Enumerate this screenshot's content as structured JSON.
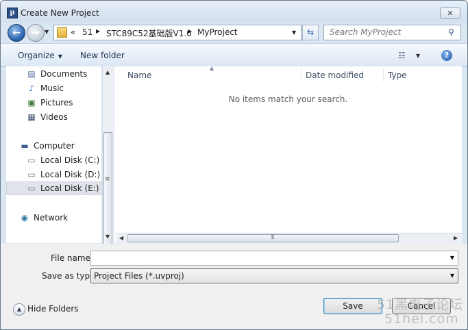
{
  "window": {
    "title": "Create New Project",
    "close_glyph": "✕",
    "app_glyph": "µ"
  },
  "nav": {
    "back_glyph": "←",
    "forward_glyph": "→",
    "history_glyph": "▼",
    "breadcrumbs": [
      "«",
      "51",
      "STC89C52基础版V1.0",
      "MyProject"
    ],
    "separator_glyph": "▶",
    "dropdown_glyph": "▼",
    "refresh_glyph": "⇆",
    "search_placeholder": "Search MyProject",
    "search_glyph": "⚲"
  },
  "toolbar": {
    "organize_label": "Organize",
    "new_folder_label": "New folder",
    "views_glyph": "☷",
    "help_glyph": "?",
    "arrow_glyph": "▼"
  },
  "sidebar": {
    "items": [
      {
        "label": "Documents",
        "icon": "documents-icon",
        "glyph": "▤"
      },
      {
        "label": "Music",
        "icon": "music-icon",
        "glyph": "♪"
      },
      {
        "label": "Pictures",
        "icon": "pictures-icon",
        "glyph": "▣"
      },
      {
        "label": "Videos",
        "icon": "videos-icon",
        "glyph": "▦"
      },
      {
        "label": "Computer",
        "icon": "computer-icon",
        "glyph": "▬"
      },
      {
        "label": "Local Disk (C:)",
        "icon": "drive-c-icon",
        "glyph": "▭"
      },
      {
        "label": "Local Disk (D:)",
        "icon": "drive-d-icon",
        "glyph": "▭"
      },
      {
        "label": "Local Disk (E:)",
        "icon": "drive-e-icon",
        "glyph": "▭",
        "selected": true
      },
      {
        "label": "Network",
        "icon": "network-icon",
        "glyph": "◉"
      }
    ],
    "scroll_up_glyph": "▲",
    "scroll_down_glyph": "▼",
    "grip_glyph": "≡"
  },
  "filelist": {
    "columns": [
      "Name",
      "Date modified",
      "Type"
    ],
    "sort_glyph": "▲",
    "empty_message": "No items match your search.",
    "scroll_left_glyph": "◀",
    "scroll_right_glyph": "▶",
    "grip_glyph": "⦀"
  },
  "form": {
    "file_name_label": "File name:",
    "file_name_value": "",
    "save_as_type_label": "Save as type:",
    "save_as_type_value": "Project Files (*.uvproj)",
    "dropdown_glyph": "▼"
  },
  "footer": {
    "hide_folders_label": "Hide Folders",
    "hide_folders_glyph": "▲",
    "save_label": "Save",
    "cancel_label": "Cancel"
  },
  "watermark": {
    "line1": "51黑电子论坛",
    "line2": "51hei.com"
  },
  "colors": {
    "accent": "#2a62b0",
    "window_bg": "#dbe6f3",
    "form_bg": "#f0f0f0"
  }
}
